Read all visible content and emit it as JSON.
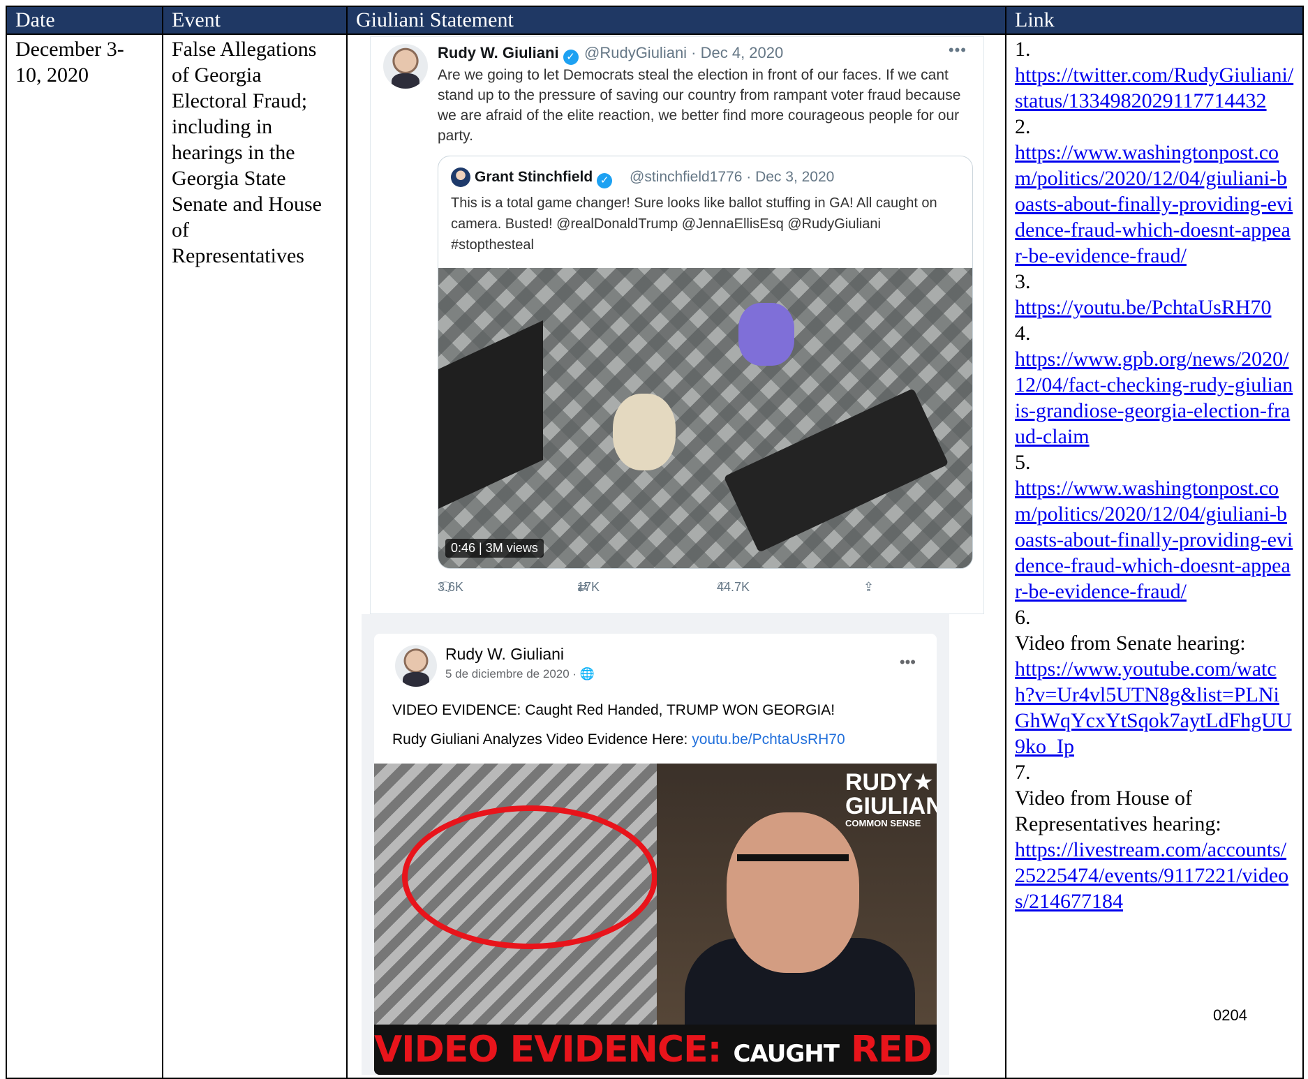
{
  "table": {
    "headers": [
      "Date",
      "Event",
      "Giuliani Statement",
      "Link"
    ],
    "date": "December 3-\n10, 2020",
    "event": "False Allegations\nof Georgia\nElectoral Fraud;\nincluding in\nhearings in the\nGeorgia State\nSenate and House\nof\nRepresentatives"
  },
  "tweet": {
    "name": "Rudy W. Giuliani",
    "handle": "@RudyGiuliani · Dec 4, 2020",
    "more": "•••",
    "text": "Are we going  to let Democrats steal the election in front of our faces. If we cant stand up to the pressure of saving our country from rampant voter fraud because we are afraid of the elite reaction, we better find more courageous people for our party.",
    "quote": {
      "name": "Grant Stinchfield",
      "handle": "@stinchfield1776 · Dec 3, 2020",
      "text": "This is a total game changer! Sure looks like ballot stuffing in GA! All caught on camera. Busted! @realDonaldTrump @JennaEllisEsq @RudyGiuliani #stopthesteal",
      "video_badge": "0:46 | 3M views"
    },
    "actions": {
      "replies": "3.6K",
      "retweets": "17K",
      "likes": "44.7K"
    }
  },
  "facebook": {
    "name": "Rudy W. Giuliani",
    "date": "5 de diciembre de 2020 · 🌐",
    "more": "•••",
    "text1": "VIDEO EVIDENCE: Caught Red Handed, TRUMP WON GEORGIA!",
    "text2_prefix": "Rudy Giuliani Analyzes Video Evidence Here: ",
    "text2_link": "youtu.be/PchtaUsRH70",
    "image_brand": "RUDY★\nGIULIANI'S",
    "image_brand_sub": "COMMON SENSE",
    "banner_red1": "VIDEO EVIDENCE:",
    "banner_white": "CAUGHT",
    "banner_red2": "RED HANDED"
  },
  "links": [
    {
      "num": "1.",
      "label": "",
      "url": "https://twitter.com/RudyGiuliani/status/1334982029117714432"
    },
    {
      "num": "2.",
      "label": "",
      "url": "https://www.washingtonpost.com/politics/2020/12/04/giuliani-boasts-about-finally-providing-evidence-fraud-which-doesnt-appear-be-evidence-fraud/"
    },
    {
      "num": "3.",
      "label": "",
      "url": "https://youtu.be/PchtaUsRH70"
    },
    {
      "num": "4.",
      "label": "",
      "url": "https://www.gpb.org/news/2020/12/04/fact-checking-rudy-giulianis-grandiose-georgia-election-fraud-claim"
    },
    {
      "num": "5.",
      "label": "",
      "url": "https://www.washingtonpost.com/politics/2020/12/04/giuliani-boasts-about-finally-providing-evidence-fraud-which-doesnt-appear-be-evidence-fraud/"
    },
    {
      "num": "6.",
      "label": "Video from Senate hearing:",
      "url": "https://www.youtube.com/watch?v=Ur4vl5UTN8g&list=PLNiGhWqYcxYtSqok7aytLdFhgUU9ko_Ip"
    },
    {
      "num": "7.",
      "label": "Video from House of Representatives hearing:",
      "url": "https://livestream.com/accounts/25225474/events/9117221/videos/214677184"
    }
  ],
  "page_number": "0204",
  "colors": {
    "header_bg": "#1f3864",
    "link": "#0000ee",
    "twitter_blue": "#1da1f2",
    "banner_red": "#e8141b"
  }
}
